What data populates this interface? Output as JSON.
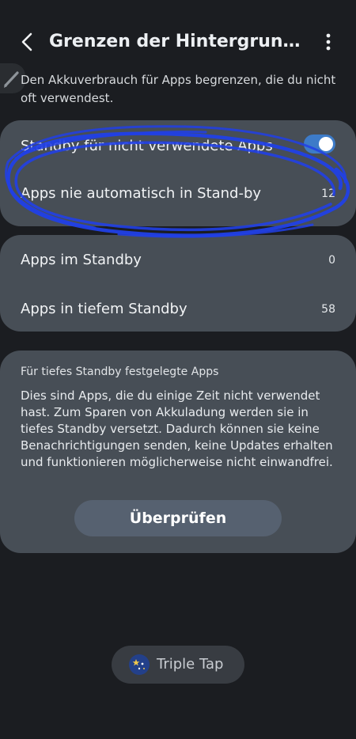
{
  "header": {
    "title": "Grenzen der Hintergrundn…",
    "back_icon": "back-arrow-icon",
    "more_icon": "more-vert-icon"
  },
  "description": "Den Akkuverbrauch für Apps begrenzen, die du nicht oft verwendest.",
  "settings_card_1": {
    "standby_unused": {
      "label": "Standby für nicht verwendete Apps",
      "enabled": true
    },
    "never_standby": {
      "label": "Apps nie automatisch in Stand-by",
      "count": "12"
    }
  },
  "settings_card_2": {
    "in_standby": {
      "label": "Apps im Standby",
      "count": "0"
    },
    "deep_standby": {
      "label": "Apps in tiefem Standby",
      "count": "58"
    }
  },
  "deep_standby_info": {
    "title": "Für tiefes Standby festgelegte Apps",
    "body": "Dies sind Apps, die du einige Zeit nicht verwendet hast. Zum Sparen von Akkuladung werden sie in tiefes Standby versetzt. Dadurch können sie keine Benachrichtigungen senden, keine Updates erhalten und funktionieren möglicherweise nicht einwandfrei.",
    "button_label": "Überprüfen"
  },
  "triple_tap": {
    "label": "Triple Tap",
    "icon": "sparkle-icon"
  },
  "colors": {
    "background": "#1b1d21",
    "card": "#474e56",
    "toggle_on": "#3d7bc8",
    "annotation": "#1f3fe0"
  }
}
